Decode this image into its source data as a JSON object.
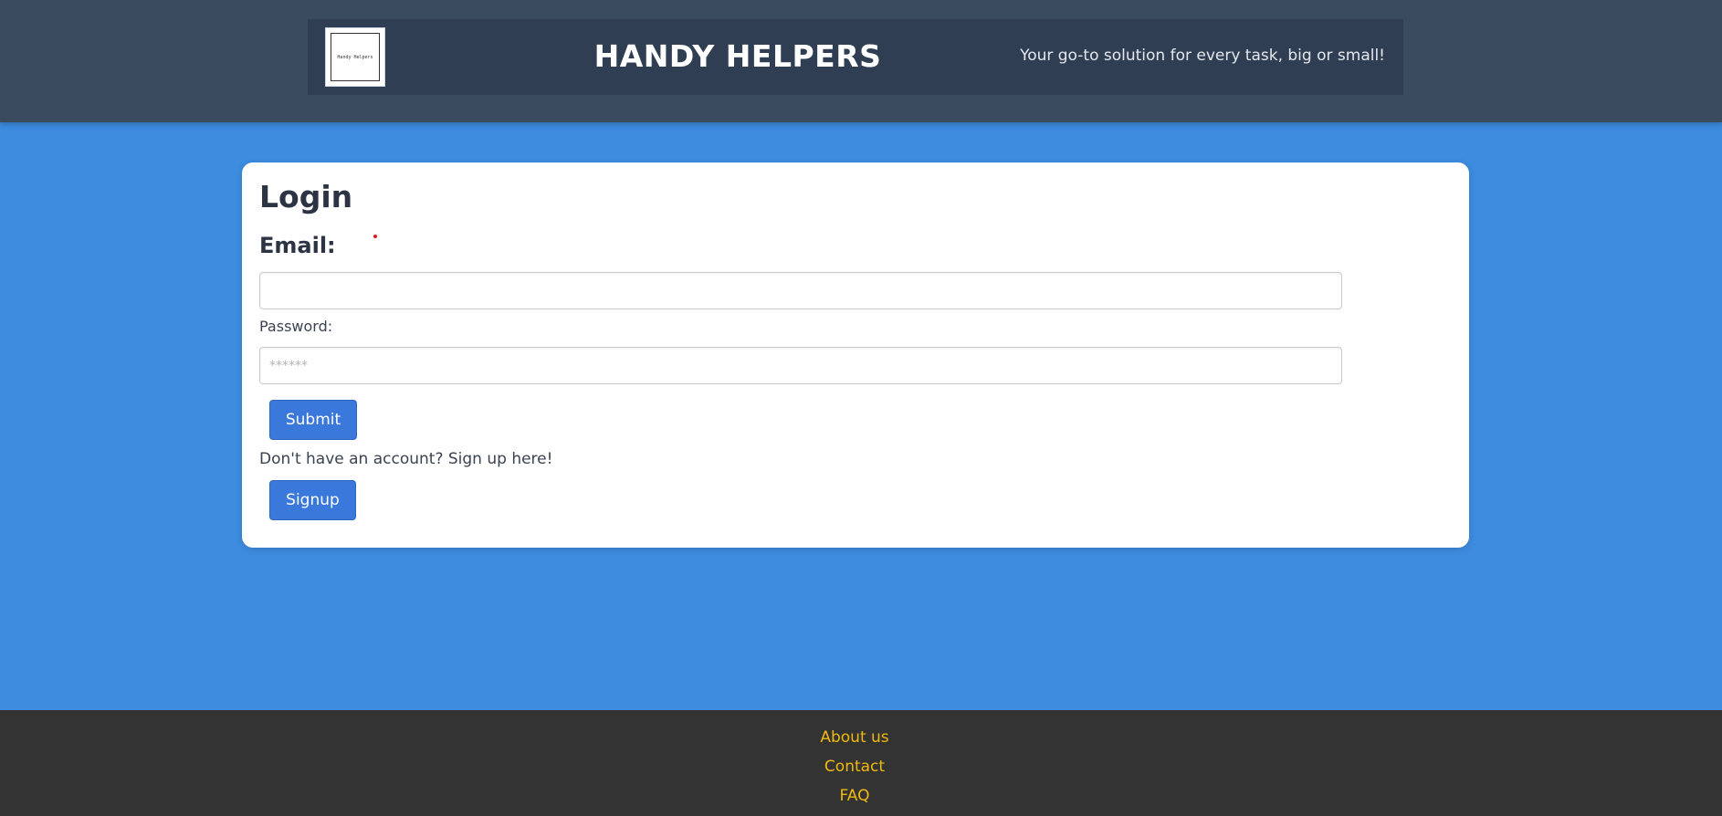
{
  "header": {
    "logo_text": "Handy Helpers",
    "title": "HANDY HELPERS",
    "tagline": "Your go-to solution for every task, big or small!"
  },
  "login": {
    "title": "Login",
    "email_label": "Email:",
    "email_value": "",
    "email_placeholder": "",
    "password_label": "Password:",
    "password_placeholder": "******",
    "submit_label": "Submit",
    "signup_prompt": "Don't have an account? Sign up here!",
    "signup_label": "Signup"
  },
  "footer": {
    "links": [
      {
        "label": "About us"
      },
      {
        "label": "Contact"
      },
      {
        "label": "FAQ"
      }
    ]
  },
  "colors": {
    "header_bg": "#3a4a5f",
    "header_inner_bg": "#2f3e52",
    "page_bg": "#3d8ce0",
    "button_bg": "#3a78db",
    "footer_bg": "#333333",
    "footer_link": "#f0b90f"
  }
}
